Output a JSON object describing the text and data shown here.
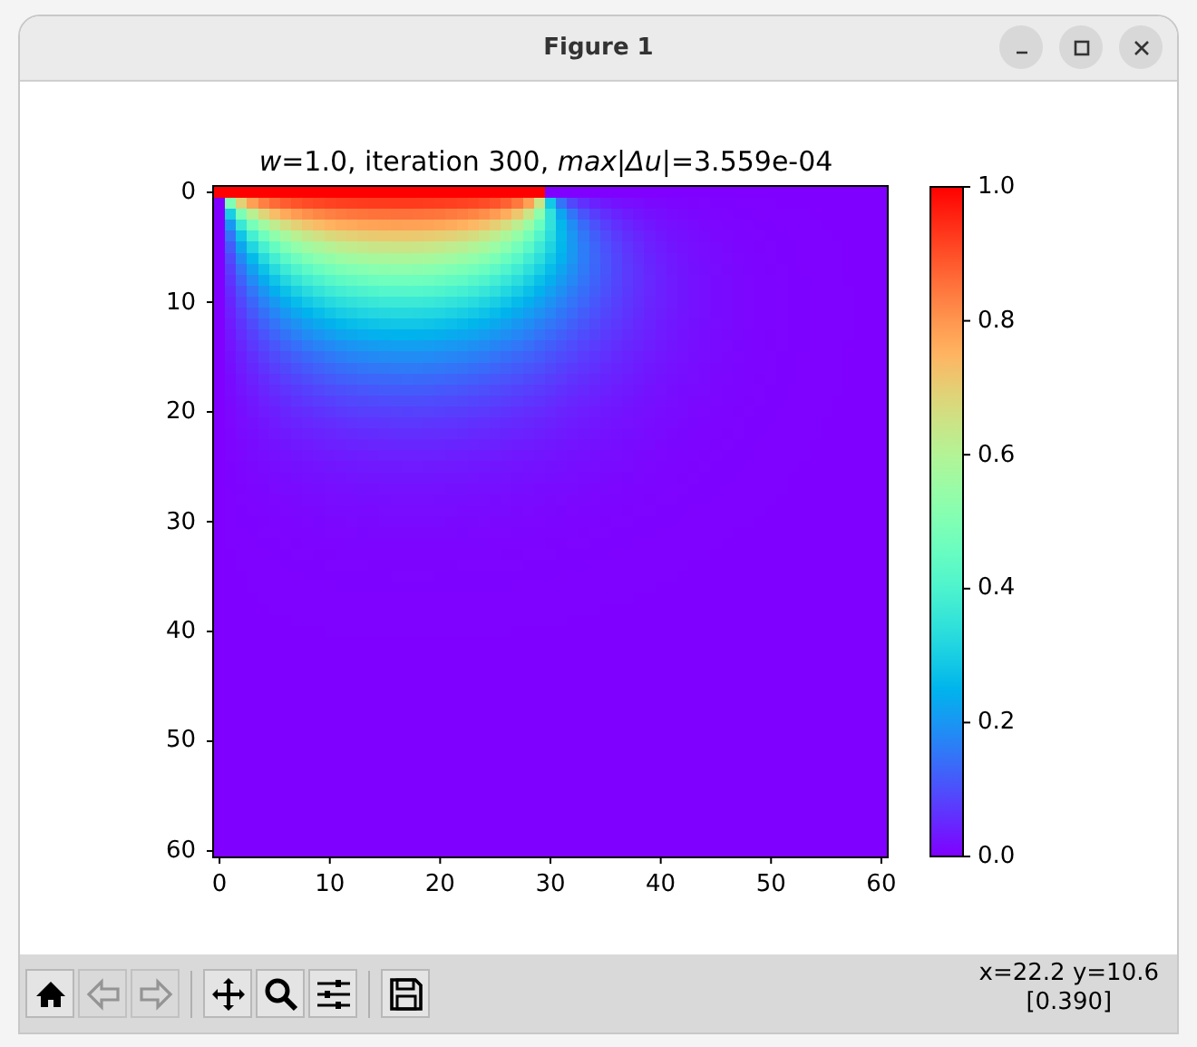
{
  "window": {
    "title": "Figure 1",
    "controls": [
      {
        "kind": "minimize"
      },
      {
        "kind": "maximize"
      },
      {
        "kind": "close"
      }
    ]
  },
  "plot": {
    "title": "*w*=1.0, iteration 300, *max*|*Δu*|=3.559e-04",
    "xticks": [
      "0",
      "10",
      "20",
      "30",
      "40",
      "50",
      "60"
    ],
    "yticks": [
      "0",
      "10",
      "20",
      "30",
      "40",
      "50",
      "60"
    ],
    "colorbar_ticks": [
      "1.0",
      "0.8",
      "0.6",
      "0.4",
      "0.2",
      "0.0"
    ]
  },
  "toolbar": {
    "buttons": [
      {
        "kind": "home",
        "disabled": false
      },
      {
        "kind": "back",
        "disabled": true
      },
      {
        "kind": "forward",
        "disabled": true
      },
      {
        "kind": "separator"
      },
      {
        "kind": "pan",
        "disabled": false
      },
      {
        "kind": "zoom",
        "disabled": false
      },
      {
        "kind": "configure",
        "disabled": false
      },
      {
        "kind": "separator"
      },
      {
        "kind": "save",
        "disabled": false
      }
    ],
    "status": [
      "x=22.2 y=10.6",
      "[0.390]"
    ]
  }
}
